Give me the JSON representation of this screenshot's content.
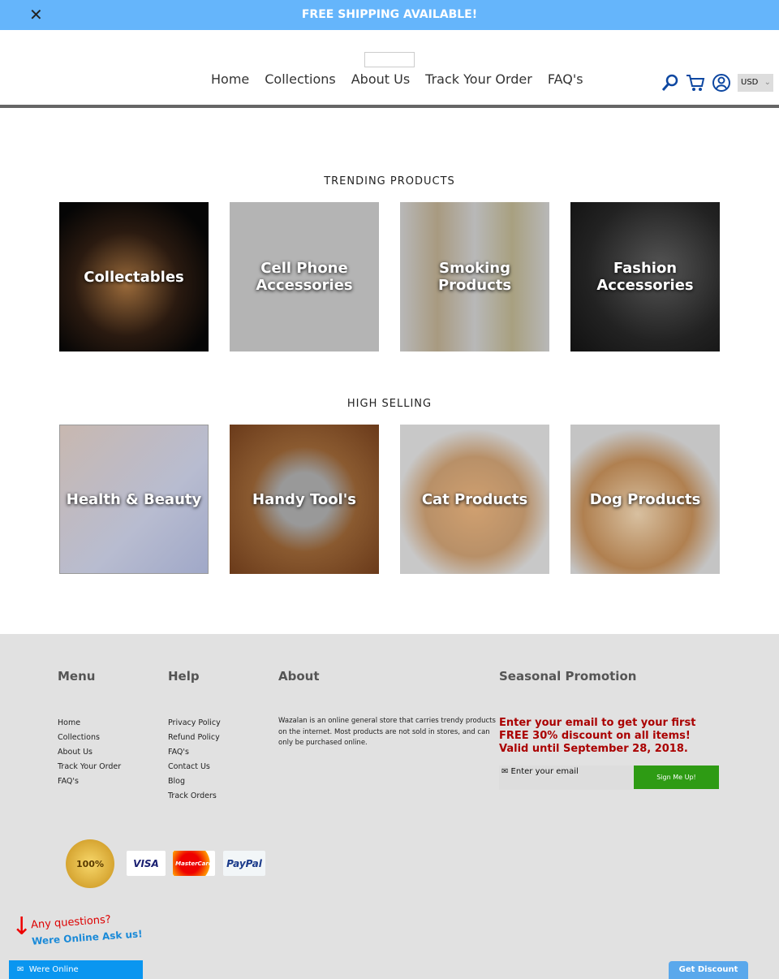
{
  "announcement": {
    "text": "FREE SHIPPING AVAILABLE!",
    "close_icon": "close-icon"
  },
  "nav": {
    "items": [
      "Home",
      "Collections",
      "About Us",
      "Track Your Order",
      "FAQ's"
    ],
    "currency": "USD"
  },
  "sections": {
    "trending": {
      "title": "TRENDING PRODUCTS",
      "tiles": [
        "Collectables",
        "Cell Phone Accessories",
        "Smoking Products",
        "Fashion Accessories"
      ]
    },
    "high_selling": {
      "title": "HIGH SELLING",
      "tiles": [
        "Health & Beauty",
        "Handy Tool's",
        "Cat Products",
        "Dog Products"
      ]
    }
  },
  "footer": {
    "menu": {
      "title": "Menu",
      "links": [
        "Home",
        "Collections",
        "About Us",
        "Track Your Order",
        "FAQ's"
      ]
    },
    "help": {
      "title": "Help",
      "links": [
        "Privacy Policy",
        "Refund Policy",
        "FAQ's",
        "Contact Us",
        "Blog",
        "Track Orders"
      ]
    },
    "about": {
      "title": "About",
      "text": "Wazalan is an online general store that carries trendy products on the internet. Most products are not sold in stores, and can only be purchased online."
    },
    "promo": {
      "title": "Seasonal Promotion",
      "text": "Enter your email to get your first FREE 30% discount on all items! Valid until September 28, 2018.",
      "email_placeholder": "✉ Enter your email",
      "button": "Sign Me Up!"
    },
    "badges": {
      "guarantee": "100%",
      "cards": [
        "VISA",
        "MasterCard",
        "PayPal"
      ]
    }
  },
  "chat": {
    "question": "Any questions?",
    "online": "Were Online Ask us!",
    "button": "Were Online"
  },
  "discount": {
    "button": "Get Discount"
  },
  "colors": {
    "announcement": "#65b5fb",
    "promo": "#aa0000",
    "signup": "#2e9b14",
    "chat": "#0a96f0"
  }
}
